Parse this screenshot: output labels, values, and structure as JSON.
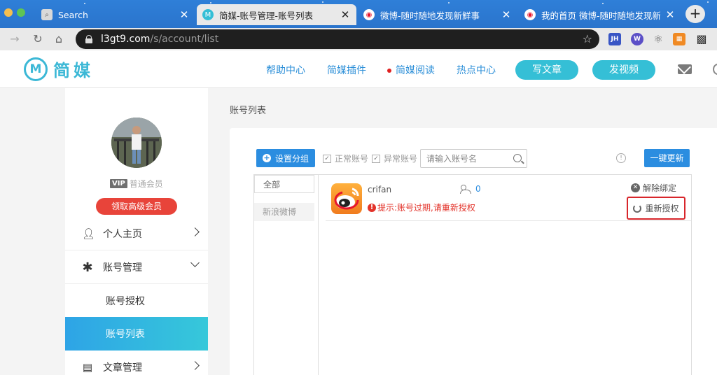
{
  "browser": {
    "tabs": [
      {
        "title": "Search",
        "active": false,
        "favicon": "search-favicon"
      },
      {
        "title": "简媒-账号管理-账号列表",
        "active": true,
        "favicon": "jianmei-favicon"
      },
      {
        "title": "微博-随时随地发现新鲜事",
        "active": false,
        "favicon": "weibo-favicon"
      },
      {
        "title": "我的首页 微博-随时随地发现新鲜事",
        "active": false,
        "favicon": "weibo-favicon"
      }
    ],
    "new_tab": "+",
    "url_host": "l3gt9.com",
    "url_path": "/s/account/list",
    "extensions": [
      "JH",
      "W",
      "react",
      "puzzle",
      "qr"
    ]
  },
  "header": {
    "logo_text": "简媒",
    "logo_mark": "M",
    "nav": [
      "帮助中心",
      "简媒插件",
      "简媒阅读",
      "热点中心"
    ],
    "btn_write": "写文章",
    "btn_video": "发视频"
  },
  "sidebar": {
    "vip_badge": "VIP",
    "member_level": "普通会员",
    "upgrade_btn": "领取高级会员",
    "items": [
      {
        "label": "个人主页"
      },
      {
        "label": "账号管理"
      },
      {
        "label": "账号授权"
      },
      {
        "label": "账号列表"
      },
      {
        "label": "文章管理"
      }
    ]
  },
  "main": {
    "breadcrumb": "账号列表",
    "btn_group": "设置分组",
    "filter_normal": "正常账号",
    "filter_abnormal": "异常账号",
    "search_placeholder": "请输入账号名",
    "btn_refresh": "一键更新",
    "categories": [
      "全部",
      "新浪微博"
    ],
    "account": {
      "name": "crifan",
      "fans": "0",
      "warning": "提示:账号过期,请重新授权",
      "unbind": "解除绑定",
      "reauth": "重新授权"
    }
  },
  "colors": {
    "accent_blue": "#2b8de0",
    "brand_teal": "#35bfd6",
    "warning_red": "#e3332a",
    "highlight_red": "#d8262b"
  }
}
